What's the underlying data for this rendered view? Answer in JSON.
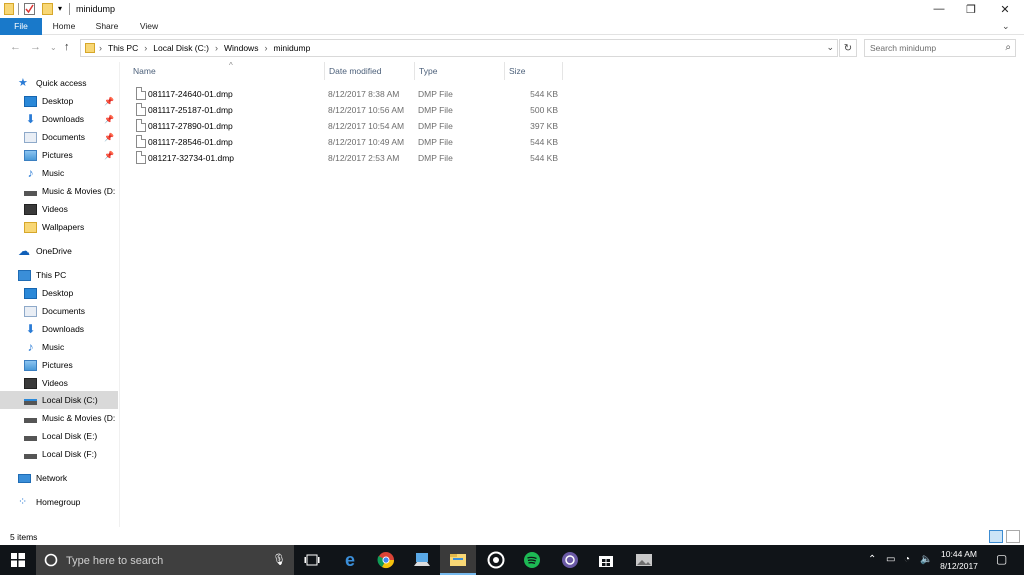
{
  "window": {
    "title": "minidump",
    "controls": {
      "minimize": "—",
      "restore": "❐",
      "close": "✕"
    }
  },
  "ribbon": {
    "tabs": [
      {
        "label": "File",
        "active": true
      },
      {
        "label": "Home"
      },
      {
        "label": "Share"
      },
      {
        "label": "View"
      }
    ]
  },
  "address": {
    "crumbs": [
      "This PC",
      "Local Disk (C:)",
      "Windows",
      "minidump"
    ],
    "search_placeholder": "Search minidump"
  },
  "nav": {
    "items": [
      {
        "label": "Quick access",
        "icon": "star-icon",
        "color": "#2a7bd5"
      },
      {
        "label": "Desktop",
        "icon": "desktop-icon",
        "color": "#2a88d8",
        "pinned": true
      },
      {
        "label": "Downloads",
        "icon": "download-icon",
        "color": "#2a7bd5",
        "pinned": true
      },
      {
        "label": "Documents",
        "icon": "documents-icon",
        "color": "#8ea9c9",
        "pinned": true
      },
      {
        "label": "Pictures",
        "icon": "pictures-icon",
        "color": "#4a9ad8",
        "pinned": true
      },
      {
        "label": "Music",
        "icon": "music-icon",
        "color": "#2a7bd5"
      },
      {
        "label": "Music & Movies (D:",
        "icon": "drive-icon",
        "color": "#555555"
      },
      {
        "label": "Videos",
        "icon": "videos-icon",
        "color": "#3a3a3a"
      },
      {
        "label": "Wallpapers",
        "icon": "folder-icon",
        "color": "#f8d775"
      },
      {
        "label": "OneDrive",
        "icon": "cloud-icon",
        "color": "#0f5fb8"
      },
      {
        "label": "This PC",
        "icon": "computer-icon",
        "color": "#3a8ed8"
      },
      {
        "label": "Desktop",
        "icon": "desktop-icon",
        "color": "#2a88d8"
      },
      {
        "label": "Documents",
        "icon": "documents-icon",
        "color": "#8ea9c9"
      },
      {
        "label": "Downloads",
        "icon": "download-icon",
        "color": "#2a7bd5"
      },
      {
        "label": "Music",
        "icon": "music-icon",
        "color": "#2a7bd5"
      },
      {
        "label": "Pictures",
        "icon": "pictures-icon",
        "color": "#4a9ad8"
      },
      {
        "label": "Videos",
        "icon": "videos-icon",
        "color": "#3a3a3a"
      },
      {
        "label": "Local Disk (C:)",
        "icon": "windows-drive-icon",
        "color": "#555555",
        "selected": true
      },
      {
        "label": "Music & Movies (D:",
        "icon": "drive-icon",
        "color": "#555555"
      },
      {
        "label": "Local Disk (E:)",
        "icon": "drive-icon",
        "color": "#555555"
      },
      {
        "label": "Local Disk (F:)",
        "icon": "drive-icon",
        "color": "#555555"
      },
      {
        "label": "Network",
        "icon": "network-icon",
        "color": "#3a8ed8"
      },
      {
        "label": "Homegroup",
        "icon": "homegroup-icon",
        "color": "#2a7bd5"
      }
    ]
  },
  "columns": [
    "Name",
    "Date modified",
    "Type",
    "Size"
  ],
  "files": [
    {
      "name": "081117-24640-01.dmp",
      "date": "8/12/2017 8:38 AM",
      "type": "DMP File",
      "size": "544 KB"
    },
    {
      "name": "081117-25187-01.dmp",
      "date": "8/12/2017 10:56 AM",
      "type": "DMP File",
      "size": "500 KB"
    },
    {
      "name": "081117-27890-01.dmp",
      "date": "8/12/2017 10:54 AM",
      "type": "DMP File",
      "size": "397 KB"
    },
    {
      "name": "081117-28546-01.dmp",
      "date": "8/12/2017 10:49 AM",
      "type": "DMP File",
      "size": "544 KB"
    },
    {
      "name": "081217-32734-01.dmp",
      "date": "8/12/2017 2:53 AM",
      "type": "DMP File",
      "size": "544 KB"
    }
  ],
  "status": {
    "items": "5 items"
  },
  "taskbar": {
    "search_placeholder": "Type here to search",
    "apps": [
      "task-view-icon",
      "edge-icon",
      "chrome-icon",
      "app-icon",
      "file-explorer-icon",
      "groove-icon",
      "spotify-icon",
      "browser-icon",
      "store-icon",
      "photos-icon"
    ],
    "time": "10:44 AM",
    "date": "8/12/2017",
    "accent": "#76b9ed"
  },
  "accent": "#1979ca"
}
